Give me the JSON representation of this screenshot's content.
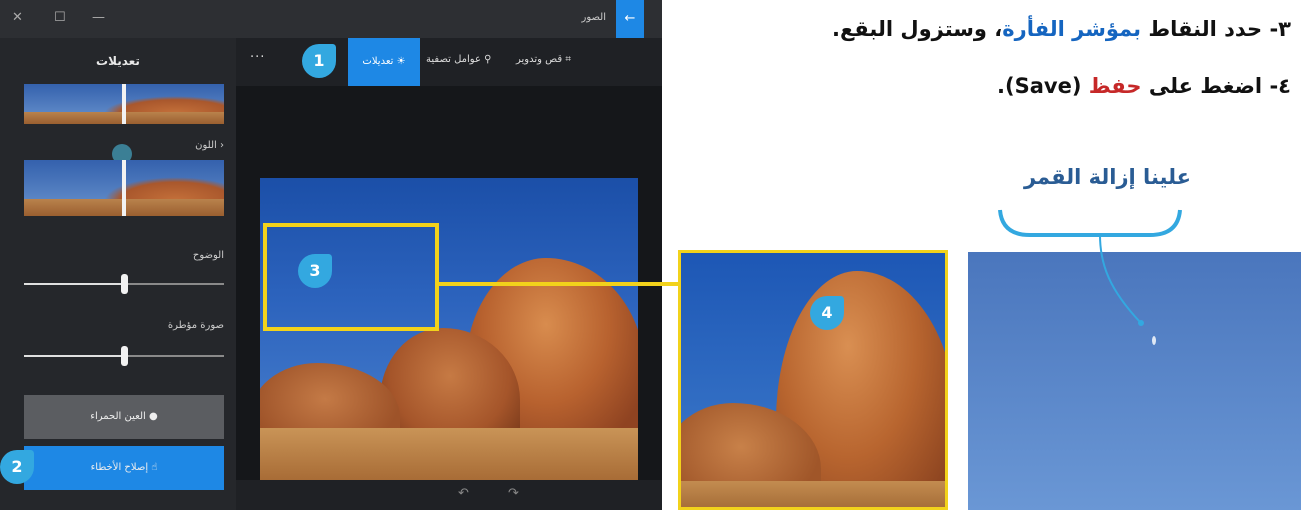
{
  "window": {
    "title": "الصور",
    "close_glyph": "✕",
    "max_glyph": "☐",
    "min_glyph": "—",
    "back_glyph": "←"
  },
  "side_panel": {
    "title": "تعديلات",
    "color_label": "اللون",
    "clarity_label": "الوضوح",
    "vignette_label": "صورة مؤطرة",
    "clarity_value": 0.5,
    "vignette_value": 0.5,
    "red_eye_label": "العين الحمراء",
    "spot_fix_label": "إصلاح الأخطاء"
  },
  "toolbar": {
    "crop_label": "قص وتدوير",
    "filters_label": "عوامل تصفية",
    "adjust_label": "تعديلات",
    "more_label": "···"
  },
  "bottombar": {
    "undo_glyph": "↶",
    "redo_glyph": "↷"
  },
  "badges": {
    "one": "1",
    "two": "2",
    "three": "3",
    "four": "4"
  },
  "instructions": {
    "step3_prefix": "٣- حدد النقاط ",
    "step3_highlight": "بمؤشر الفأرة",
    "step3_suffix": "، وستزول البقع.",
    "step4_prefix": "٤- اضغط على ",
    "step4_highlight": "حفظ",
    "step4_suffix": " (Save)."
  },
  "annotation": {
    "moon_note": "علينا إزالة القمر"
  },
  "colors": {
    "accent": "#1e88e5",
    "highlight_box": "#f2d21b",
    "badge": "#33a8e0",
    "blue_text": "#1565c0",
    "red_text": "#c62828"
  }
}
